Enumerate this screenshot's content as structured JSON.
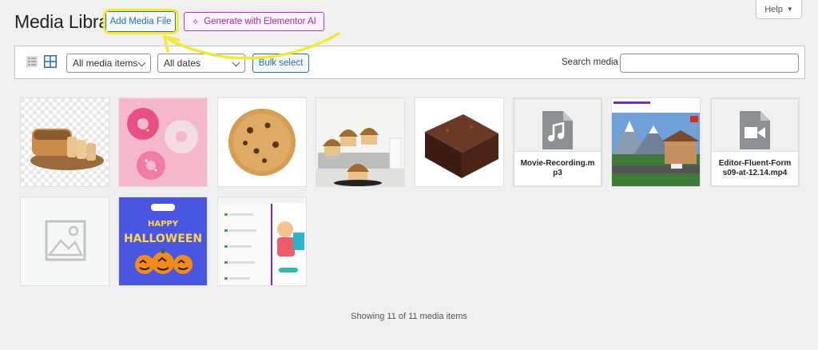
{
  "header": {
    "title": "Media Library",
    "add_button": "Add Media File",
    "ai_button": "Generate with Elementor AI",
    "help_button": "Help"
  },
  "toolbar": {
    "type_filter": "All media items",
    "date_filter": "All dates",
    "bulk_select": "Bulk select",
    "search_label": "Search media",
    "search_value": ""
  },
  "media": [
    {
      "kind": "image",
      "subject": "bread-loaf"
    },
    {
      "kind": "image",
      "subject": "donuts"
    },
    {
      "kind": "image",
      "subject": "cookie"
    },
    {
      "kind": "image",
      "subject": "muffins"
    },
    {
      "kind": "image",
      "subject": "brownie"
    },
    {
      "kind": "file",
      "name": "Movie-Recording.mp3",
      "icon": "audio-file-icon"
    },
    {
      "kind": "image",
      "subject": "mountain-village-video"
    },
    {
      "kind": "file",
      "name": "Editor-Fluent-Forms09-at-12.14.mp4",
      "icon": "video-file-icon"
    },
    {
      "kind": "image",
      "subject": "placeholder"
    },
    {
      "kind": "image",
      "subject": "halloween-banner",
      "text_top": "HAPPY",
      "text_main": "HALLOWEEN"
    },
    {
      "kind": "image",
      "subject": "forms-screenshot"
    }
  ],
  "status": "Showing 11 of 11 media items",
  "colors": {
    "accent": "#2271b1",
    "ai_accent": "#a42ba3",
    "highlight": "#f2ea3a",
    "background": "#f0f0f1"
  }
}
